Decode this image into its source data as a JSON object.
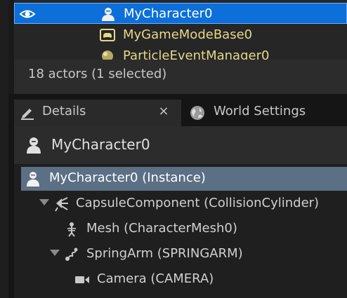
{
  "outliner": {
    "rows": [
      {
        "label": "MyCharacter0",
        "icon": "character-icon",
        "selected": true
      },
      {
        "label": "MyGameModeBase0",
        "icon": "gamemode-icon",
        "selected": false
      },
      {
        "label": "ParticleEventManager0",
        "icon": "actor-sphere-icon",
        "selected": false
      }
    ],
    "status": "18 actors (1 selected)"
  },
  "tabs": [
    {
      "label": "Details",
      "icon": "details-pencil-icon",
      "close_label": "×",
      "active": true
    },
    {
      "label": "World Settings",
      "icon": "world-globe-icon",
      "active": false
    }
  ],
  "details": {
    "header_label": "MyCharacter0",
    "components": [
      {
        "label": "MyCharacter0 (Instance)",
        "icon": "character-icon",
        "selected": true
      },
      {
        "label": "CapsuleComponent (CollisionCylinder)",
        "icon": "capsule-icon",
        "expanded": true
      },
      {
        "label": "Mesh (CharacterMesh0)",
        "icon": "skeleton-icon"
      },
      {
        "label": "SpringArm (SPRINGARM)",
        "icon": "springarm-icon",
        "expanded": true
      },
      {
        "label": "Camera (CAMERA)",
        "icon": "camera-icon"
      }
    ]
  },
  "colors": {
    "selection_blue": "#0d6fd9",
    "component_selected": "#5b6f85",
    "actor_label_yellow": "#e6d88a"
  }
}
